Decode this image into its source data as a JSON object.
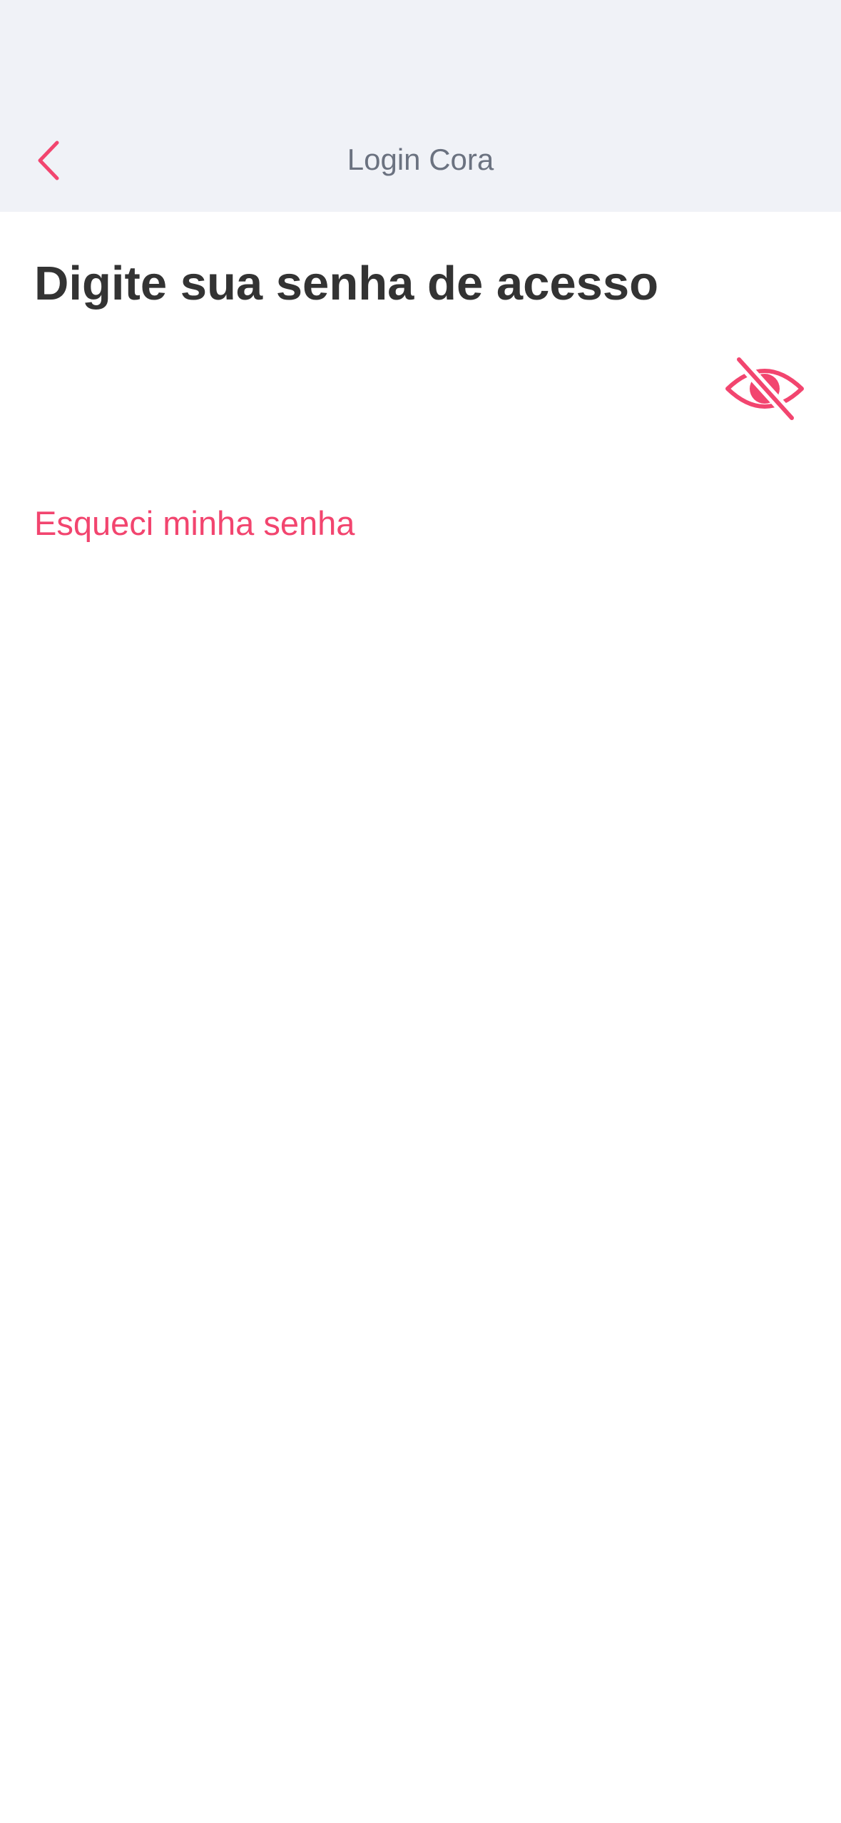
{
  "header": {
    "title": "Login Cora",
    "back_icon": "chevron-left-icon"
  },
  "main": {
    "title": "Digite sua senha de acesso",
    "password": {
      "value": "",
      "placeholder": "",
      "visibility_icon": "eye-off-icon"
    },
    "forgot_link": "Esqueci minha senha"
  },
  "colors": {
    "accent": "#f2456f",
    "header_background": "#f0f2f7",
    "title_text": "#333333",
    "header_text": "#6b7280"
  }
}
